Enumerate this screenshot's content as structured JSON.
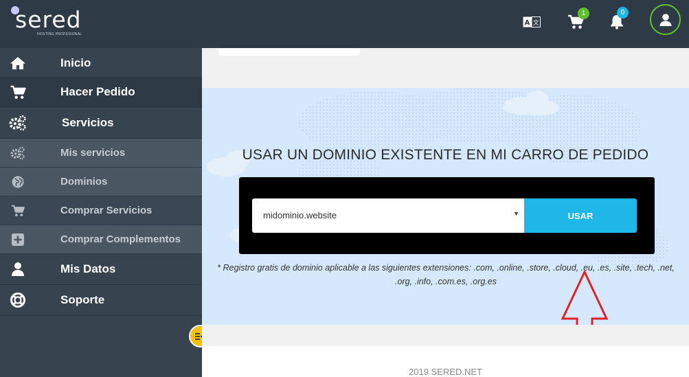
{
  "brand": {
    "name": "sered",
    "tagline": "HOSTING PROFESIONAL"
  },
  "header": {
    "cart_count": "1",
    "notifications_count": "0"
  },
  "sidebar": {
    "items": [
      {
        "label": "Inicio",
        "icon": "home-icon"
      },
      {
        "label": "Hacer Pedido",
        "icon": "cart-icon"
      },
      {
        "label": "Servicios",
        "icon": "gears-icon"
      },
      {
        "label": "Mis servicios",
        "icon": "gears-icon"
      },
      {
        "label": "Dominios",
        "icon": "globe-icon"
      },
      {
        "label": "Comprar Servicios",
        "icon": "cart-icon"
      },
      {
        "label": "Comprar Complementos",
        "icon": "plus-square-icon"
      },
      {
        "label": "Mis Datos",
        "icon": "user-icon"
      },
      {
        "label": "Soporte",
        "icon": "lifebuoy-icon"
      }
    ]
  },
  "main": {
    "title": "USAR UN DOMINIO EXISTENTE EN MI CARRO DE PEDIDO",
    "domain_select_value": "midominio.website",
    "use_button": "USAR",
    "note": "* Registro gratis de dominio aplicable a las siguientes extensiones: .com, .online, .store, .cloud, .eu, .es, .site, .tech, .net, .org, .info, .com.es, .org.es",
    "footer": "2019 SERED.NET"
  },
  "colors": {
    "header_bg": "#2e3a46",
    "sidebar_bg": "#37434f",
    "accent_blue": "#1fb6e8",
    "cart_badge": "#5fbf2a",
    "bell_badge": "#1fb6e8",
    "toggle": "#f4c20d",
    "arrow": "#e0202a"
  }
}
